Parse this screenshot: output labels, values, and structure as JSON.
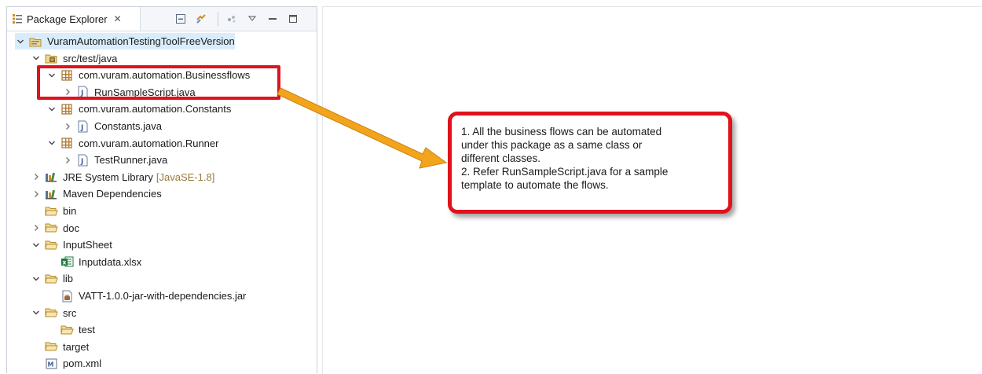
{
  "explorer": {
    "tab_title": "Package Explorer",
    "tab_close": "✕"
  },
  "tree": [
    {
      "id": "project",
      "label": "VuramAutomationTestingToolFreeVersion",
      "icon": "project-icon",
      "twisty": "expanded",
      "indent": 0
    },
    {
      "id": "src-test-java",
      "label": "src/test/java",
      "icon": "source-folder-icon",
      "twisty": "expanded",
      "indent": 1
    },
    {
      "id": "pkg-businessflows",
      "label": "com.vuram.automation.Businessflows",
      "icon": "package-icon",
      "twisty": "expanded",
      "indent": 2
    },
    {
      "id": "runsamplescript",
      "label": "RunSampleScript.java",
      "icon": "java-file-icon",
      "twisty": "collapsed",
      "indent": 3
    },
    {
      "id": "pkg-constants",
      "label": "com.vuram.automation.Constants",
      "icon": "package-icon",
      "twisty": "expanded",
      "indent": 2
    },
    {
      "id": "constants-java",
      "label": "Constants.java",
      "icon": "java-file-icon",
      "twisty": "collapsed",
      "indent": 3
    },
    {
      "id": "pkg-runner",
      "label": "com.vuram.automation.Runner",
      "icon": "package-icon",
      "twisty": "expanded",
      "indent": 2
    },
    {
      "id": "testrunner-java",
      "label": "TestRunner.java",
      "icon": "java-file-icon",
      "twisty": "collapsed",
      "indent": 3
    },
    {
      "id": "jre",
      "label": "JRE System Library",
      "decoration": "[JavaSE-1.8]",
      "icon": "library-icon",
      "twisty": "collapsed",
      "indent": 1
    },
    {
      "id": "maven",
      "label": "Maven Dependencies",
      "icon": "library-icon",
      "twisty": "collapsed",
      "indent": 1
    },
    {
      "id": "bin",
      "label": "bin",
      "icon": "folder-icon",
      "twisty": "none",
      "indent": 1
    },
    {
      "id": "doc",
      "label": "doc",
      "icon": "folder-icon",
      "twisty": "collapsed",
      "indent": 1
    },
    {
      "id": "inputsheet",
      "label": "InputSheet",
      "icon": "folder-icon",
      "twisty": "expanded",
      "indent": 1
    },
    {
      "id": "inputdata",
      "label": "Inputdata.xlsx",
      "icon": "excel-file-icon",
      "twisty": "none",
      "indent": 2
    },
    {
      "id": "lib",
      "label": "lib",
      "icon": "folder-icon",
      "twisty": "expanded",
      "indent": 1
    },
    {
      "id": "vatt-jar",
      "label": "VATT-1.0.0-jar-with-dependencies.jar",
      "icon": "jar-file-icon",
      "twisty": "none",
      "indent": 2
    },
    {
      "id": "src",
      "label": "src",
      "icon": "folder-icon",
      "twisty": "expanded",
      "indent": 1
    },
    {
      "id": "test",
      "label": "test",
      "icon": "folder-icon",
      "twisty": "none",
      "indent": 2
    },
    {
      "id": "target",
      "label": "target",
      "icon": "folder-icon",
      "twisty": "none",
      "indent": 1
    },
    {
      "id": "pom",
      "label": "pom.xml",
      "icon": "maven-pom-icon",
      "twisty": "none",
      "indent": 1
    }
  ],
  "callout": {
    "line1": "1. All the business flows can be automated",
    "line2": "under this package as a same class or",
    "line3": "different classes.",
    "line4": "2. Refer RunSampleScript.java for a sample",
    "line5": "template to automate the flows."
  },
  "colors": {
    "highlight_red": "#e0121d",
    "arrow_orange": "#f2a51c",
    "selection_blue": "#d9ecfb"
  }
}
